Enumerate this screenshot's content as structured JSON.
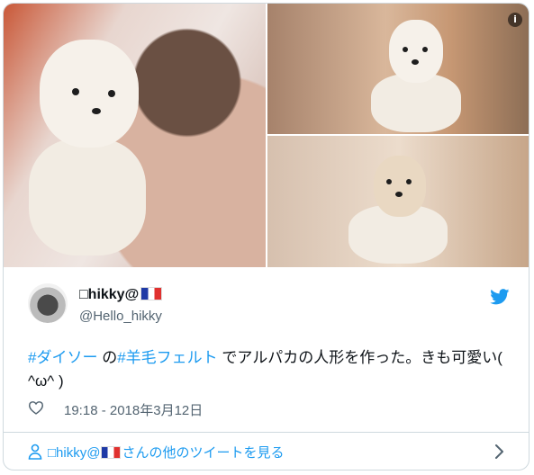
{
  "tweet": {
    "author": {
      "display_name": "□hikky@",
      "handle": "@Hello_hikky"
    },
    "text": {
      "tag1": "#ダイソー",
      "mid1": " の",
      "tag2": "#羊毛フェルト",
      "rest": " でアルパカの人形を作った。きも可愛い( ^ω^ )"
    },
    "timestamp": "19:18 - 2018年3月12日",
    "footer": {
      "name": "□hikky@",
      "suffix": "さんの他のツイートを見る"
    },
    "info_icon": "i"
  },
  "icons": {
    "info": "info-icon",
    "bird": "twitter-bird-icon",
    "heart": "heart-icon",
    "person": "person-icon",
    "chevron": "chevron-right-icon",
    "flag": "france-flag-icon"
  },
  "colors": {
    "accent": "#1d9bf0",
    "text": "#0f1419",
    "muted": "#536471",
    "border": "#cfd9de"
  }
}
